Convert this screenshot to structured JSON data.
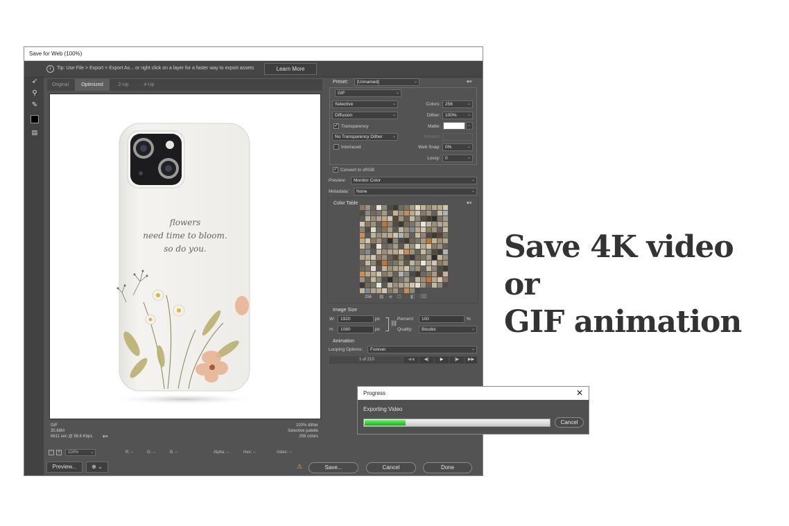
{
  "dialog": {
    "title": "Save for Web (100%)",
    "tip_text": "Tip: Use File > Export > Export As...  or right click on a layer for a faster way to export assets",
    "learn_more": "Learn More",
    "tabs": [
      "Original",
      "Optimized",
      "2-Up",
      "4-Up"
    ],
    "active_tab": "Optimized",
    "canvas_info": {
      "left": [
        "GIF",
        "35.68M",
        "6611 sec @ 56.6 Kbps"
      ],
      "right": [
        "100% dither",
        "Selective palette",
        "256 colors"
      ]
    },
    "phone_text": [
      "flowers",
      "need time to bloom.",
      "so do you."
    ],
    "status": {
      "zoom": "100%",
      "r": "R: --",
      "g": "G: --",
      "b": "B: --",
      "alpha": "Alpha: --",
      "hex": "Hex: --",
      "index": "Index: --"
    },
    "buttons": {
      "preview": "Preview...",
      "save": "Save...",
      "cancel": "Cancel",
      "done": "Done"
    }
  },
  "panel": {
    "preset_label": "Preset:",
    "preset_value": "[Unnamed]",
    "format": "GIF",
    "reduction": "Selective",
    "dither_algo": "Diffusion",
    "transparency_label": "Transparency",
    "transparency_checked": true,
    "transparency_dither": "No Transparency Dither",
    "interlaced_label": "Interlaced",
    "interlaced_checked": false,
    "colors_label": "Colors:",
    "colors_value": "256",
    "dither_label": "Dither:",
    "dither_value": "100%",
    "matte_label": "Matte:",
    "amount_label": "Amount:",
    "websnap_label": "Web Snap:",
    "websnap_value": "0%",
    "lossy_label": "Lossy:",
    "lossy_value": "0",
    "convert_srgb_label": "Convert to sRGB",
    "convert_srgb_checked": true,
    "preview_label": "Preview:",
    "preview_value": "Monitor Color",
    "metadata_label": "Metadata:",
    "metadata_value": "None",
    "color_table_label": "Color Table",
    "color_count": "256",
    "image_size_label": "Image Size",
    "w_label": "W:",
    "w_value": "1920",
    "h_label": "H:",
    "h_value": "1080",
    "px": "px",
    "percent_label": "Percent:",
    "percent_value": "100",
    "percent_unit": "%",
    "quality_label": "Quality:",
    "quality_value": "Bicubic",
    "animation_label": "Animation",
    "looping_label": "Looping Options:",
    "looping_value": "Forever",
    "frame_counter": "1 of 210",
    "swatch_colors": [
      "#8a7a62",
      "#6f6a5a",
      "#b9a88c",
      "#4f4a42",
      "#9c8f78",
      "#c7b9a0",
      "#5e5a50",
      "#a0917a",
      "#7b7666",
      "#d2c6b0",
      "#3e3b35",
      "#b3a58c",
      "#8d8676",
      "#c1b49c",
      "#66615a",
      "#a89b84"
    ]
  },
  "progress": {
    "title": "Progress",
    "close": "✕",
    "message": "Exporting Video",
    "cancel": "Cancel",
    "fraction": 0.22
  },
  "headline": {
    "line1": "Save 4K video or",
    "line2": "GIF animation"
  }
}
